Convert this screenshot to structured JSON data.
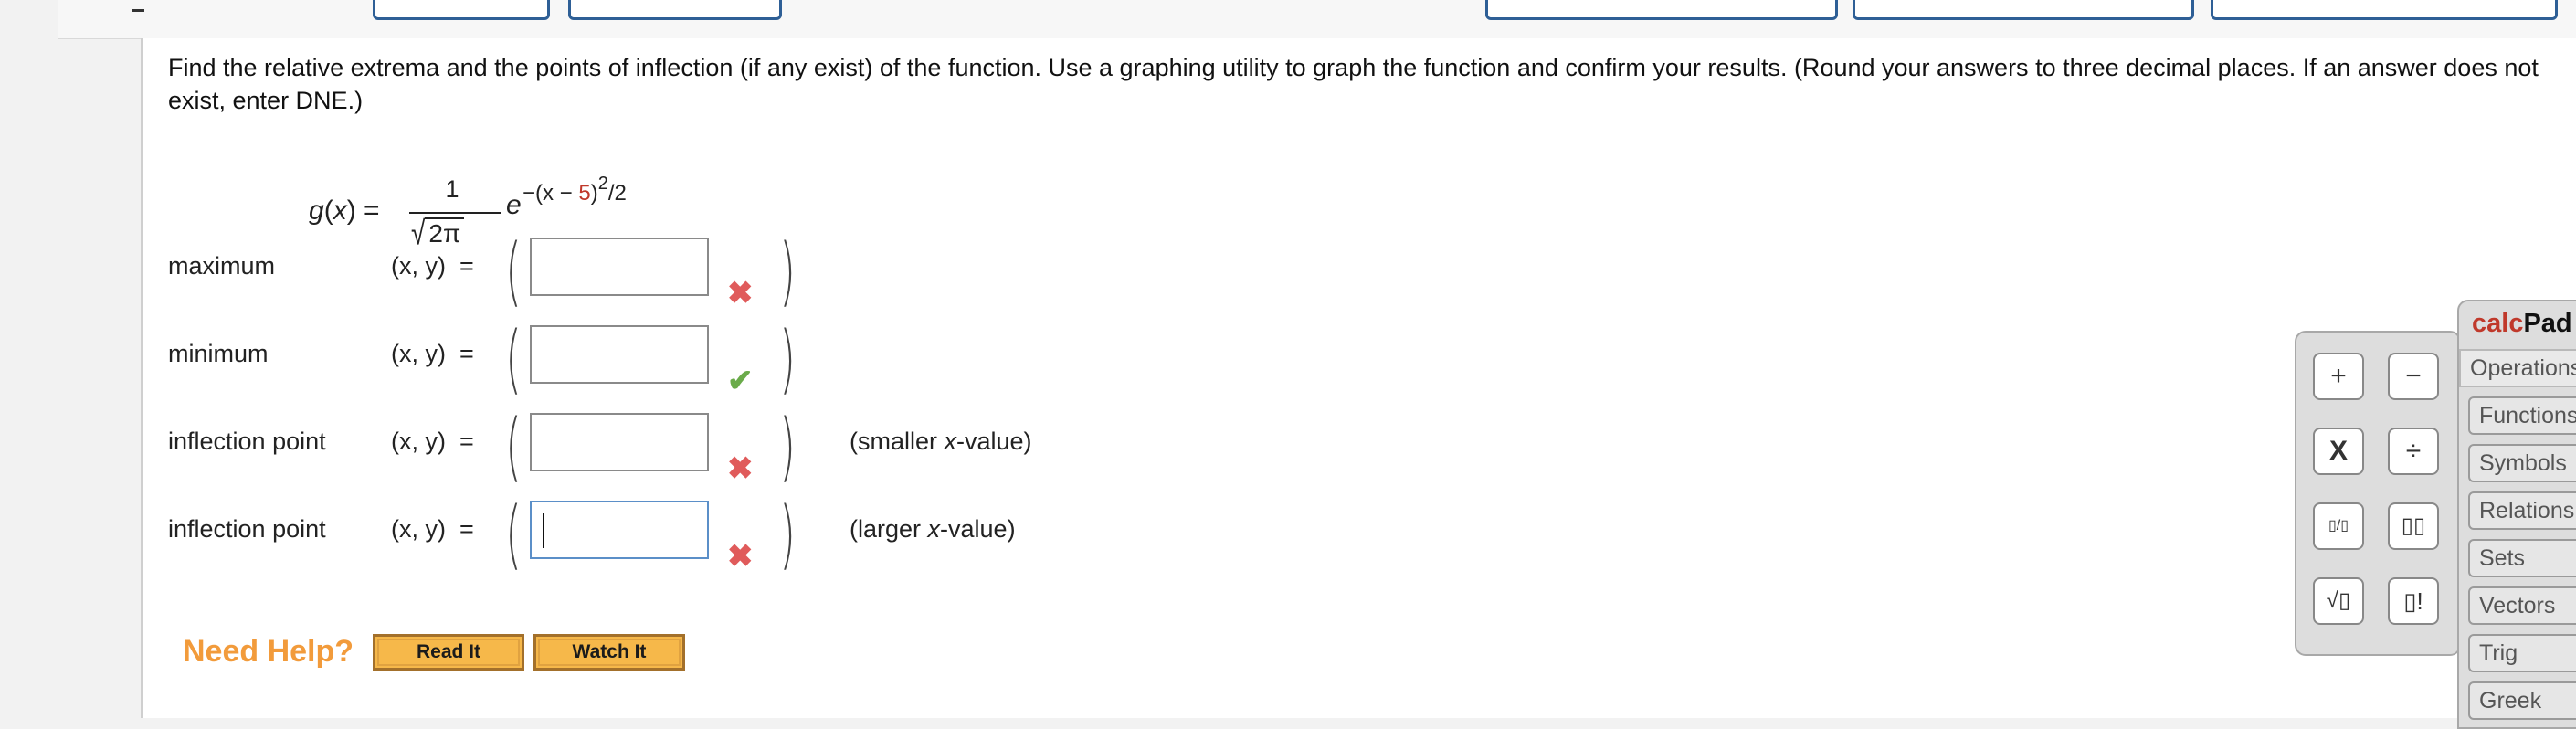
{
  "problem": {
    "text": "Find the relative extrema and the points of inflection (if any exist) of the function. Use a graphing utility to graph the function and confirm your results. (Round your answers to three decimal places. If an answer does not exist, enter DNE.)"
  },
  "function": {
    "lhs_name": "g",
    "lhs_arg": "x",
    "equals": "=",
    "numerator": "1",
    "den_radical": "√",
    "den_inner": "2π",
    "base": "e",
    "exp_prefix": "−(x − ",
    "exp_shift": "5",
    "exp_close": ")",
    "exp_power": "2",
    "exp_suffix": "/2"
  },
  "rows": [
    {
      "label": "maximum",
      "xy": "(x, y)",
      "eq": "=",
      "value": "",
      "status": "incorrect",
      "status_icon": "x-mark-icon",
      "note": ""
    },
    {
      "label": "minimum",
      "xy": "(x, y)",
      "eq": "=",
      "value": "",
      "status": "correct",
      "status_icon": "check-mark-icon",
      "note": ""
    },
    {
      "label": "inflection point",
      "xy": "(x, y)",
      "eq": "=",
      "value": "",
      "status": "incorrect",
      "status_icon": "x-mark-icon",
      "note_pre": "(smaller ",
      "note_var": "x",
      "note_post": "-value)"
    },
    {
      "label": "inflection point",
      "xy": "(x, y)",
      "eq": "=",
      "value": "",
      "status": "incorrect",
      "status_icon": "x-mark-icon",
      "note_pre": "(larger ",
      "note_var": "x",
      "note_post": "-value)"
    }
  ],
  "help": {
    "need_help": "Need Help?",
    "read_it": "Read It",
    "watch_it": "Watch It"
  },
  "calcpad": {
    "title_calc": "calc",
    "title_pad": "Pad",
    "buttons": [
      "+",
      "−",
      "X",
      "÷",
      "▯/▯",
      "▯▯",
      "√▯",
      "▯!"
    ],
    "tabs": [
      "Operations",
      "Functions",
      "Symbols",
      "Relations",
      "Sets",
      "Vectors",
      "Trig",
      "Greek"
    ]
  },
  "colors": {
    "accent_blue": "#2e5f96",
    "help_orange": "#f29b3b",
    "incorrect_red": "#e05b5b",
    "correct_green": "#6aab4a",
    "calc_red": "#c0392b"
  }
}
